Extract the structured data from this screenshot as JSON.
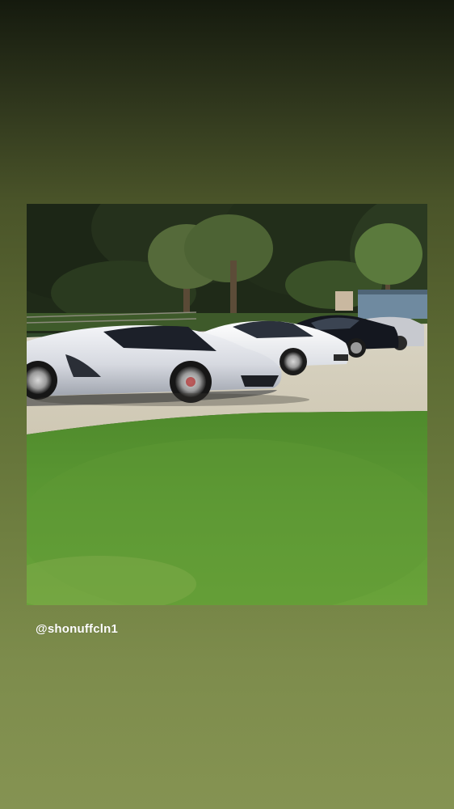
{
  "story": {
    "caption": "@shonuffcln1"
  },
  "theme": {
    "background_top": "#151a0e",
    "background_bottom": "#859352",
    "caption_color": "#ffffff"
  },
  "media": {
    "type": "photo"
  }
}
